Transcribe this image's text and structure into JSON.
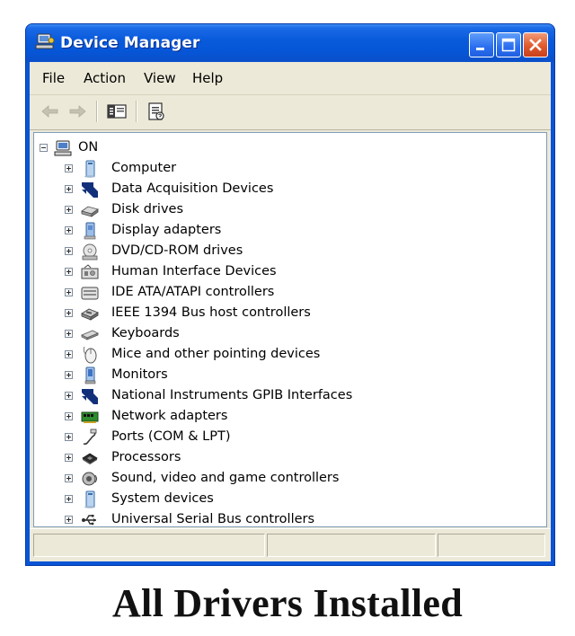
{
  "window": {
    "title": "Device Manager",
    "title_icon": "computer-manage-icon",
    "buttons": [
      "minimize",
      "maximize",
      "close"
    ]
  },
  "menu": {
    "items": [
      {
        "label": "File"
      },
      {
        "label": "Action"
      },
      {
        "label": "View"
      },
      {
        "label": "Help"
      }
    ]
  },
  "toolbar": {
    "buttons": [
      {
        "icon": "back-arrow-icon",
        "enabled": false
      },
      {
        "icon": "forward-arrow-icon",
        "enabled": false
      },
      {
        "icon": "show-hide-console-tree-icon",
        "enabled": true
      },
      {
        "icon": "properties-icon",
        "enabled": true
      }
    ]
  },
  "tree": {
    "root": {
      "label": "ON",
      "icon": "computer-icon",
      "expanded": true
    },
    "items": [
      {
        "label": "Computer",
        "icon": "computer-icon"
      },
      {
        "label": "Data Acquisition Devices",
        "icon": "national-instruments-icon"
      },
      {
        "label": "Disk drives",
        "icon": "disk-drive-icon"
      },
      {
        "label": "Display adapters",
        "icon": "display-adapter-icon"
      },
      {
        "label": "DVD/CD-ROM drives",
        "icon": "cd-drive-icon"
      },
      {
        "label": "Human Interface Devices",
        "icon": "hid-icon"
      },
      {
        "label": "IDE ATA/ATAPI controllers",
        "icon": "ide-controller-icon"
      },
      {
        "label": "IEEE 1394 Bus host controllers",
        "icon": "firewire-icon"
      },
      {
        "label": "Keyboards",
        "icon": "keyboard-icon"
      },
      {
        "label": "Mice and other pointing devices",
        "icon": "mouse-icon"
      },
      {
        "label": "Monitors",
        "icon": "monitor-icon"
      },
      {
        "label": "National Instruments GPIB Interfaces",
        "icon": "national-instruments-icon"
      },
      {
        "label": "Network adapters",
        "icon": "network-adapter-icon"
      },
      {
        "label": "Ports (COM & LPT)",
        "icon": "port-icon"
      },
      {
        "label": "Processors",
        "icon": "processor-icon"
      },
      {
        "label": "Sound, video and game controllers",
        "icon": "sound-icon"
      },
      {
        "label": "System devices",
        "icon": "system-device-icon"
      },
      {
        "label": "Universal Serial Bus controllers",
        "icon": "usb-icon"
      }
    ]
  },
  "caption": "All Drivers Installed",
  "colors": {
    "title_bar": "#0a5bdc",
    "window_frame": "#0a54d6",
    "close_button": "#e05a2c",
    "client_background": "#ece9d8",
    "tree_background": "#ffffff"
  }
}
